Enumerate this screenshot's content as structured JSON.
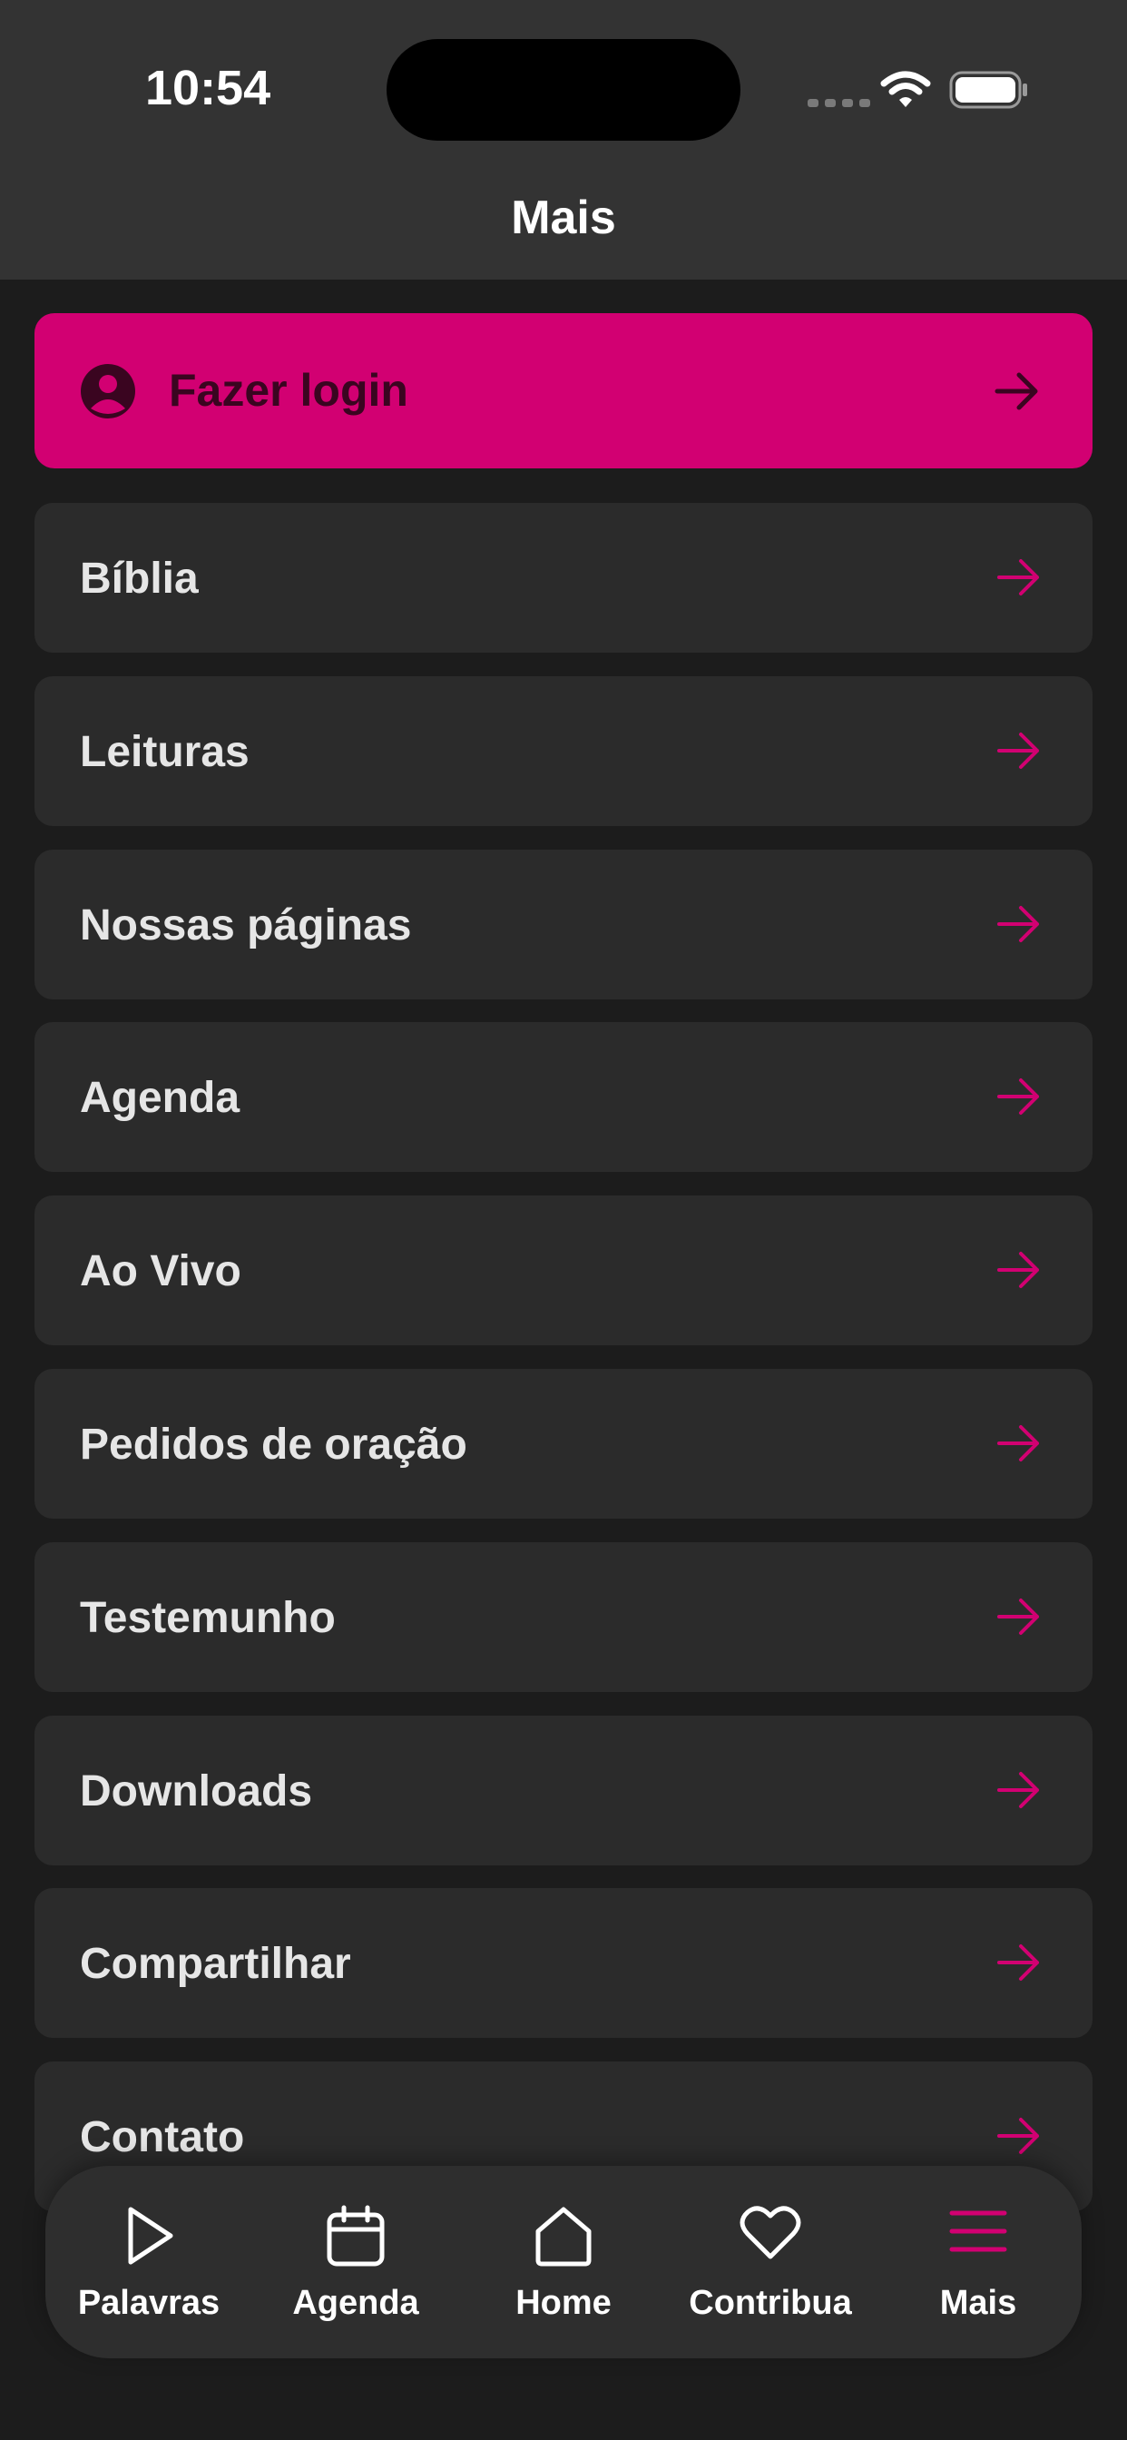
{
  "status_bar": {
    "time": "10:54"
  },
  "header": {
    "title": "Mais"
  },
  "login": {
    "label": "Fazer login"
  },
  "menu": [
    {
      "label": "Bíblia"
    },
    {
      "label": "Leituras"
    },
    {
      "label": "Nossas páginas"
    },
    {
      "label": "Agenda"
    },
    {
      "label": "Ao Vivo"
    },
    {
      "label": "Pedidos de oração"
    },
    {
      "label": "Testemunho"
    },
    {
      "label": "Downloads"
    },
    {
      "label": "Compartilhar"
    },
    {
      "label": "Contato"
    }
  ],
  "tabbar": {
    "tabs": [
      {
        "label": "Palavras",
        "icon": "play-icon"
      },
      {
        "label": "Agenda",
        "icon": "calendar-icon"
      },
      {
        "label": "Home",
        "icon": "home-icon"
      },
      {
        "label": "Contribua",
        "icon": "heart-icon"
      },
      {
        "label": "Mais",
        "icon": "menu-icon",
        "active": true
      }
    ]
  },
  "colors": {
    "accent": "#d20072",
    "background": "#1c1c1c",
    "header": "#333333",
    "card": "#2b2b2b"
  }
}
